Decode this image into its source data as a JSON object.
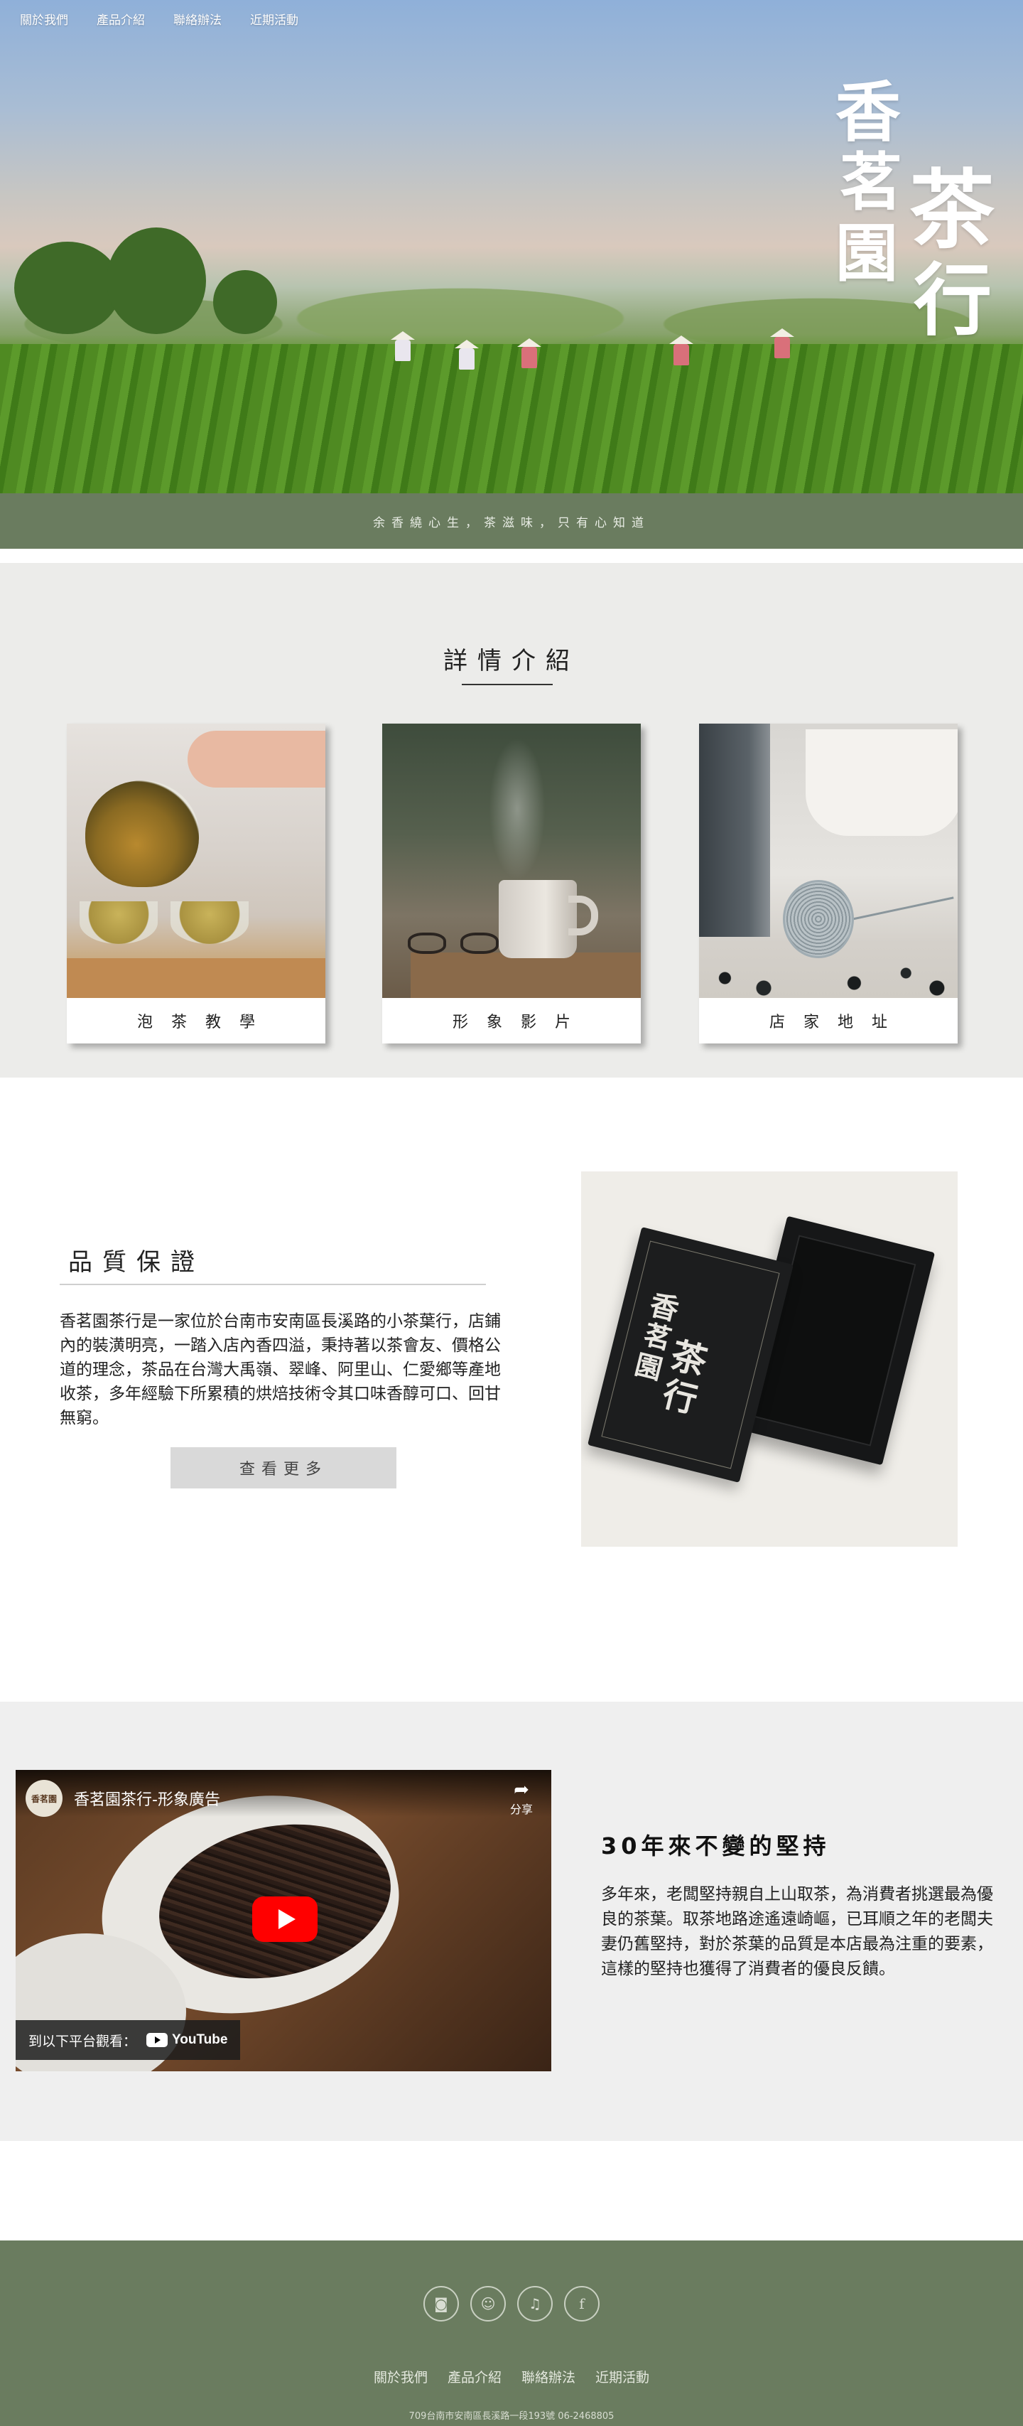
{
  "nav": {
    "items": [
      "關於我們",
      "產品介紹",
      "聯絡辦法",
      "近期活動"
    ]
  },
  "hero": {
    "logo_chars": [
      "香",
      "茗",
      "園",
      "茶",
      "行"
    ]
  },
  "tagline": "余香繞心生，茶滋味，只有心知道",
  "details": {
    "title": "詳情介紹",
    "cards": [
      {
        "label": "泡茶教學"
      },
      {
        "label": "形象影片"
      },
      {
        "label": "店家地址"
      }
    ]
  },
  "quality": {
    "title": "品質保證",
    "body": "香茗園茶行是一家位於台南市安南區長溪路的小茶葉行，店鋪內的裝潢明亮，一踏入店內香四溢，秉持著以茶會友、價格公道的理念，茶品在台灣大禹嶺、翠峰、阿里山、仁愛鄉等產地收茶，多年經驗下所累積的烘焙技術令其口味香醇可口、回甘無窮。",
    "more_button": "查看更多"
  },
  "video": {
    "channel_badge": "香茗園",
    "title": "香茗園茶行-形象廣告",
    "share_label": "分享",
    "watch_label": "到以下平台觀看：",
    "platform_label": "YouTube"
  },
  "story": {
    "title": "30年來不變的堅持",
    "body": "多年來，老闆堅持親自上山取茶，為消費者挑選最為優良的茶葉。取茶地路途遙遠崎嶇，已耳順之年的老闆夫妻仍舊堅持，對於茶葉的品質是本店最為注重的要素，這樣的堅持也獲得了消費者的優良反饋。"
  },
  "footer": {
    "social_icons": [
      "instagram-icon",
      "snapchat-icon",
      "twitter-icon",
      "facebook-icon"
    ],
    "nav": [
      "關於我們",
      "產品介紹",
      "聯絡辦法",
      "近期活動"
    ],
    "address": "709台南市安南區長溪路一段193號 06-2468805"
  },
  "colors": {
    "brand_green": "#6a7c5f",
    "section_gray": "#ececea",
    "button_gray": "#d9d9d9",
    "youtube_red": "#ff0000"
  }
}
